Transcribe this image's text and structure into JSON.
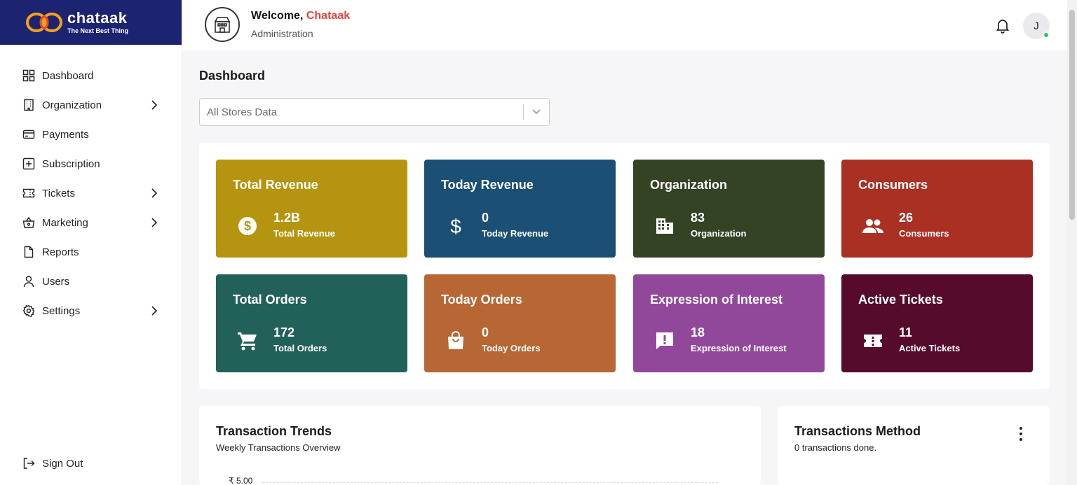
{
  "brand": {
    "name": "chataak",
    "tagline": "The Next Best Thing"
  },
  "header": {
    "welcome_prefix": "Welcome, ",
    "user_name": "Chataak",
    "role": "Administration",
    "avatar_initial": "J"
  },
  "sidebar": {
    "items": [
      {
        "label": "Dashboard",
        "icon": "grid-icon",
        "has_submenu": false
      },
      {
        "label": "Organization",
        "icon": "building-icon",
        "has_submenu": true
      },
      {
        "label": "Payments",
        "icon": "card-icon",
        "has_submenu": false
      },
      {
        "label": "Subscription",
        "icon": "plus-square-icon",
        "has_submenu": false
      },
      {
        "label": "Tickets",
        "icon": "ticket-icon",
        "has_submenu": true
      },
      {
        "label": "Marketing",
        "icon": "basket-icon",
        "has_submenu": true
      },
      {
        "label": "Reports",
        "icon": "file-icon",
        "has_submenu": false
      },
      {
        "label": "Users",
        "icon": "user-icon",
        "has_submenu": false
      },
      {
        "label": "Settings",
        "icon": "gear-icon",
        "has_submenu": true
      }
    ],
    "signout_label": "Sign Out"
  },
  "main": {
    "title": "Dashboard",
    "store_filter": {
      "value": "All Stores Data"
    },
    "stats": [
      {
        "title": "Total Revenue",
        "value": "1.2B",
        "sub": "Total Revenue",
        "color": "#b5950f",
        "icon": "coin-icon"
      },
      {
        "title": "Today Revenue",
        "value": "0",
        "sub": "Today Revenue",
        "color": "#1b4f74",
        "icon": "dollar-icon"
      },
      {
        "title": "Organization",
        "value": "83",
        "sub": "Organization",
        "color": "#344323",
        "icon": "building-icon"
      },
      {
        "title": "Consumers",
        "value": "26",
        "sub": "Consumers",
        "color": "#aa3024",
        "icon": "people-icon"
      },
      {
        "title": "Total Orders",
        "value": "172",
        "sub": "Total Orders",
        "color": "#22605a",
        "icon": "cart-icon"
      },
      {
        "title": "Today Orders",
        "value": "0",
        "sub": "Today Orders",
        "color": "#b76634",
        "icon": "bag-icon"
      },
      {
        "title": "Expression of Interest",
        "value": "18",
        "sub": "Expression of Interest",
        "color": "#92489a",
        "icon": "alert-message-icon"
      },
      {
        "title": "Active Tickets",
        "value": "11",
        "sub": "Active Tickets",
        "color": "#560b2c",
        "icon": "ticket-icon"
      }
    ],
    "trends": {
      "title": "Transaction Trends",
      "subtitle": "Weekly Transactions Overview",
      "y_tick": "₹ 5.00"
    },
    "method": {
      "title": "Transactions Method",
      "subtitle": "0 transactions done."
    }
  }
}
